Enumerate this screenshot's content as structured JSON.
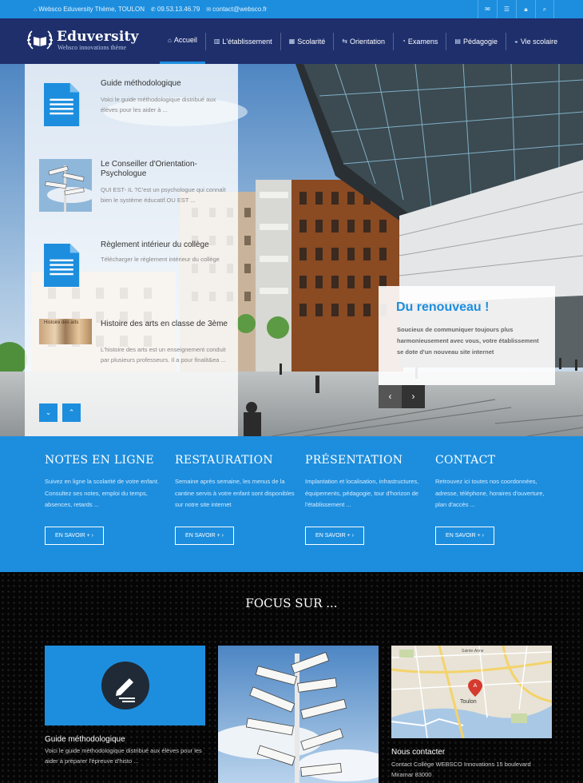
{
  "topbar": {
    "org": "Websco Eduversity Thème, TOULON",
    "phone": "09.53.13.46.79",
    "email": "contact@websco.fr",
    "icons": [
      "mail-icon",
      "rss-icon",
      "lock-icon",
      "search-icon"
    ]
  },
  "header": {
    "brand_name": "Eduversity",
    "brand_tagline": "Websco innovations thème",
    "nav": [
      {
        "label": "Accueil",
        "icon": "home-icon"
      },
      {
        "label": "L'établissement",
        "icon": "building-icon"
      },
      {
        "label": "Scolarité",
        "icon": "school-icon"
      },
      {
        "label": "Orientation",
        "icon": "signpost-icon"
      },
      {
        "label": "Examens",
        "icon": "exam-icon"
      },
      {
        "label": "Pédagogie",
        "icon": "books-icon"
      },
      {
        "label": "Vie scolaire",
        "icon": "student-life-icon"
      }
    ]
  },
  "hero": {
    "cards": [
      {
        "title": "Guide méthodologique",
        "desc": "Voici le guide méthodologique distribué aux élèves pour les aider à ..."
      },
      {
        "title": "Le Conseiller d'Orientation-Psychologue",
        "desc": "QUI EST- IL ?C'est un psychologue qui connaît bien le système éducatif.OU EST ..."
      },
      {
        "title": "Règlement intérieur du collège",
        "desc": "Télécharger le règlement intérieur du collège"
      },
      {
        "title": "Histoire des arts en classe de 3ème",
        "desc": "L'histoire des arts est un enseignement conduit par plusieurs professeurs. Il a pour finalit&ea ..."
      }
    ],
    "card4_thumb_caption": "Histoire des arts",
    "promo": {
      "title": "Du renouveau !",
      "text": "Soucieux de communiquer toujours plus harmonieusement avec vous, votre établissement se dote d'un nouveau site internet"
    }
  },
  "band": {
    "columns": [
      {
        "title": "NOTES EN LIGNE",
        "desc": "Suivez en ligne la scolarité de votre enfant. Consultez ses notes, emploi du temps, absences, retards ...",
        "button": "EN SAVOIR +"
      },
      {
        "title": "RESTAURATION",
        "desc": "Semaine après semaine, les menus de la cantine servis à votre enfant sont disponibles sur notre site internet",
        "button": "EN SAVOIR +"
      },
      {
        "title": "PRÉSENTATION",
        "desc": "Implantation et localisation, infrastructures, équipements, pédagogie, tour d'horizon de l'établissement ...",
        "button": "EN SAVOIR +"
      },
      {
        "title": "CONTACT",
        "desc": "Retrouvez ici toutes nos coordonnées, adresse, téléphone, horaires d'ouverture, plan d'accès ...",
        "button": "EN SAVOIR +"
      }
    ]
  },
  "focus": {
    "title": "FOCUS SUR ...",
    "cards": [
      {
        "title": "Guide méthodologique",
        "desc": "Voici le guide méthodologique distribué aux élèves pour les aider à préparer l'épreuve d'histo ..."
      },
      {
        "title": "",
        "desc": ""
      },
      {
        "title": "Nous contacter",
        "desc": "Contact Collège WEBSCO Innovations 15 boulevard Miramar 83000"
      }
    ],
    "map_labels": [
      "Toulon",
      "Sainte-Anne"
    ]
  },
  "colors": {
    "accent": "#1d8ede",
    "header_bg": "#1e2f6c",
    "promo_title": "#1d8ede",
    "focus_bg": "#050505"
  }
}
